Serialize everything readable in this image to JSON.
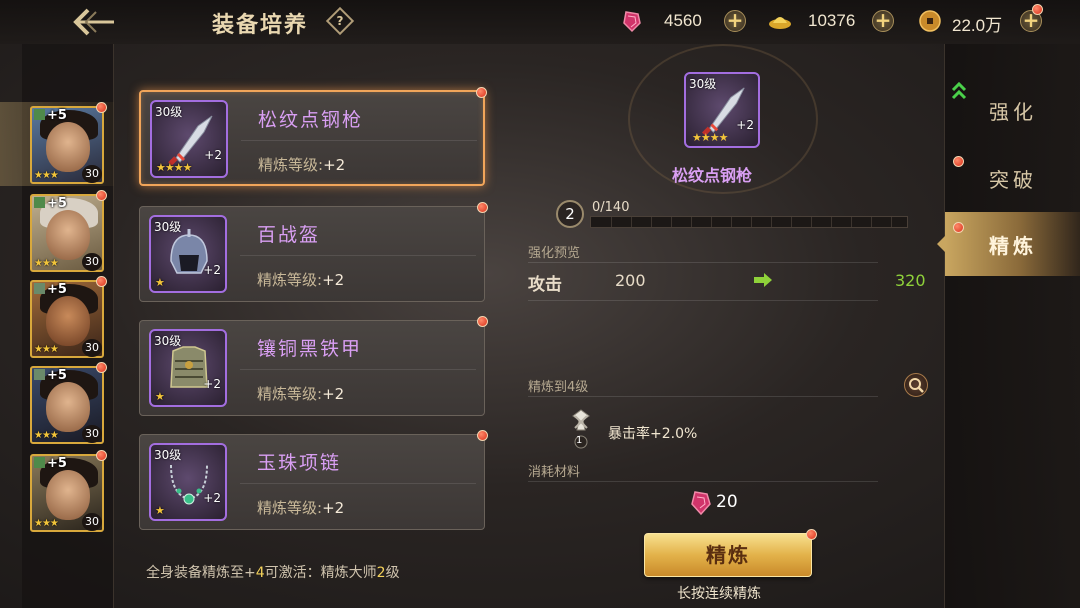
{
  "header": {
    "title": "装备培养",
    "help_label": "?"
  },
  "currencies": [
    {
      "name": "gem-icon",
      "value": "4560"
    },
    {
      "name": "gold-ingot-icon",
      "value": "10376"
    },
    {
      "name": "coin-icon",
      "value": "22.0万"
    }
  ],
  "heroes": [
    {
      "plus": "+5",
      "stars": "★★★",
      "level": "30",
      "selected": true
    },
    {
      "plus": "+5",
      "stars": "★★★",
      "level": "30",
      "selected": false
    },
    {
      "plus": "+5",
      "stars": "★★★",
      "level": "30",
      "selected": false
    },
    {
      "plus": "+5",
      "stars": "★★★",
      "level": "30",
      "selected": false
    },
    {
      "plus": "+5",
      "stars": "★★★",
      "level": "30",
      "selected": false
    }
  ],
  "equipment": [
    {
      "level": "30级",
      "plus": "+2",
      "stars": "★★★★",
      "name": "松纹点钢枪",
      "refine_label": "精炼等级:",
      "refine_value": "+2"
    },
    {
      "level": "30级",
      "plus": "+2",
      "stars": "★",
      "name": "百战盔",
      "refine_label": "精炼等级:",
      "refine_value": "+2"
    },
    {
      "level": "30级",
      "plus": "+2",
      "stars": "★",
      "name": "镶铜黑铁甲",
      "refine_label": "精炼等级:",
      "refine_value": "+2"
    },
    {
      "level": "30级",
      "plus": "+2",
      "stars": "★",
      "name": "玉珠项链",
      "refine_label": "精炼等级:",
      "refine_value": "+2"
    }
  ],
  "bottom_note": {
    "prefix": "全身装备精炼至+",
    "level": "4",
    "middle": "可激活：精炼大师",
    "master_level": "2",
    "suffix": "级"
  },
  "detail": {
    "item_level": "30级",
    "item_plus": "+2",
    "item_stars": "★★★★",
    "item_name": "松纹点钢枪",
    "progress_level": "2",
    "progress_text": "0/140",
    "progress_fraction": 0,
    "preview_label": "强化预览",
    "stat_name": "攻击",
    "stat_old": "200",
    "stat_new": "320",
    "refine_to_label": "精炼到4级",
    "skill_badge": "1",
    "skill_text": "暴击率+2.0%",
    "materials_label": "消耗材料",
    "material_count": "20",
    "refine_button": "精炼",
    "hold_tip": "长按连续精炼"
  },
  "tabs": [
    {
      "label": "强化",
      "active": false
    },
    {
      "label": "突破",
      "active": false
    },
    {
      "label": "精炼",
      "active": true
    }
  ],
  "colors": {
    "accent_gold": "#e3b24a",
    "item_name_purple": "#d99ff3",
    "stat_increase_green": "#8fd23a",
    "highlight_yellow": "#f4d25a"
  }
}
